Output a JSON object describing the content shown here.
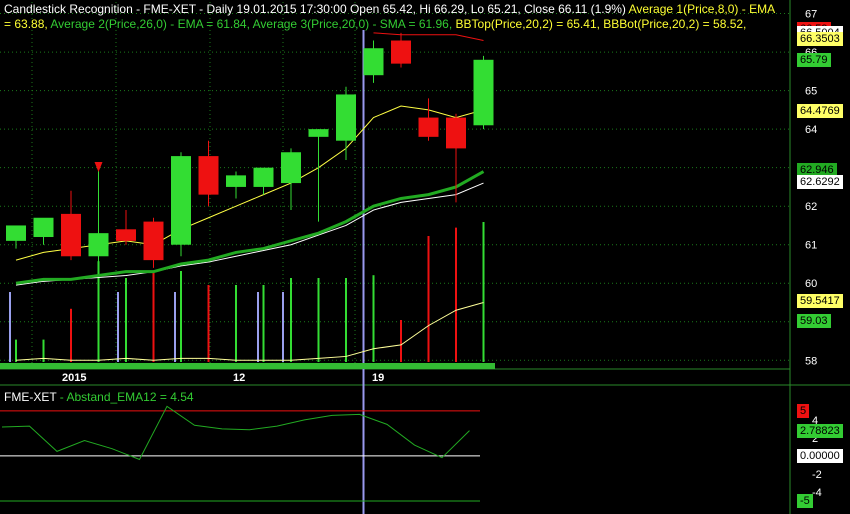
{
  "header": {
    "title": "Candlestick Recognition - FME-XET - Daily 19.01.2015 17:30:00 Open 65.42, Hi 66.29, Lo 65.21, Close 66.11 (1.9%)",
    "ma1_label": "Average 1(Price,8,0) - EMA",
    "ma1_value": "= 63.88,",
    "ma2_label": "Average 2(Price,26,0) - EMA = 61.84,",
    "ma3_label": "Average 3(Price,20,0) - SMA = 61.96,",
    "bbtop_label": "BBTop(Price,20,2) = 65.41,",
    "bbbot_label": "BBBot(Price,20,2) = 58.52,"
  },
  "subpanel": {
    "title": "FME-XET",
    "indicator": "- Abstand_EMA12 = 4.54"
  },
  "colors": {
    "bull": "#33dd33",
    "bear": "#ee1111",
    "ema8": "#ffff44",
    "ema26": "#22aa22",
    "sma20": "#66dd66",
    "bb": "#ffff99",
    "grid": "#1b7a1b",
    "cursor": "#9999ee"
  },
  "chart_data": [
    {
      "type": "candlestick",
      "x_ticks": [
        "2015",
        "12",
        "19"
      ],
      "y_ticks": [
        58,
        59,
        60,
        61,
        62,
        63,
        64,
        65,
        66,
        67
      ],
      "ylim": [
        57.8,
        67.3
      ],
      "candles": [
        {
          "open": 61.1,
          "high": 61.4,
          "low": 60.9,
          "close": 61.5
        },
        {
          "open": 61.2,
          "high": 61.6,
          "low": 61.0,
          "close": 61.7
        },
        {
          "open": 61.8,
          "high": 62.4,
          "low": 60.6,
          "close": 60.7
        },
        {
          "open": 60.7,
          "high": 63.1,
          "low": 60.3,
          "close": 61.3
        },
        {
          "open": 61.4,
          "high": 61.9,
          "low": 61.0,
          "close": 61.1
        },
        {
          "open": 61.6,
          "high": 61.7,
          "low": 60.4,
          "close": 60.6
        },
        {
          "open": 61.0,
          "high": 63.4,
          "low": 60.7,
          "close": 63.3
        },
        {
          "open": 63.3,
          "high": 63.7,
          "low": 62.0,
          "close": 62.3
        },
        {
          "open": 62.5,
          "high": 62.9,
          "low": 62.2,
          "close": 62.8
        },
        {
          "open": 62.5,
          "high": 62.9,
          "low": 62.3,
          "close": 63.0
        },
        {
          "open": 62.6,
          "high": 63.5,
          "low": 61.9,
          "close": 63.4
        },
        {
          "open": 63.8,
          "high": 64.0,
          "low": 61.6,
          "close": 64.0
        },
        {
          "open": 63.7,
          "high": 65.1,
          "low": 63.2,
          "close": 64.9
        },
        {
          "open": 65.4,
          "high": 66.3,
          "low": 65.2,
          "close": 66.1
        },
        {
          "open": 66.3,
          "high": 66.5,
          "low": 65.6,
          "close": 65.7
        },
        {
          "open": 64.3,
          "high": 64.8,
          "low": 63.7,
          "close": 63.8
        },
        {
          "open": 64.3,
          "high": 64.4,
          "low": 62.1,
          "close": 63.5
        },
        {
          "open": 64.1,
          "high": 65.9,
          "low": 64.0,
          "close": 65.8
        }
      ],
      "ema8": [
        60.6,
        60.8,
        60.9,
        61.0,
        61.1,
        61.0,
        61.4,
        61.7,
        62.0,
        62.3,
        62.6,
        63.0,
        63.5,
        64.3,
        64.6,
        64.5,
        64.3,
        64.5
      ],
      "ema26": [
        60.0,
        60.1,
        60.1,
        60.2,
        60.3,
        60.3,
        60.5,
        60.6,
        60.8,
        60.9,
        61.1,
        61.3,
        61.6,
        62.0,
        62.2,
        62.3,
        62.5,
        62.9
      ],
      "sma20": [
        59.95,
        60.05,
        60.1,
        60.15,
        60.2,
        60.3,
        60.45,
        60.55,
        60.7,
        60.85,
        61.0,
        61.25,
        61.5,
        61.9,
        62.1,
        62.2,
        62.3,
        62.6
      ],
      "bbtop": [
        null,
        null,
        null,
        null,
        null,
        null,
        null,
        null,
        null,
        null,
        null,
        null,
        null,
        66.5,
        66.45,
        66.45,
        66.45,
        66.3
      ],
      "bbbot": [
        58.0,
        58.05,
        58.0,
        58.0,
        58.05,
        58.0,
        58.05,
        58.05,
        58.0,
        58.0,
        58.0,
        58.05,
        58.1,
        58.3,
        58.4,
        58.9,
        59.3,
        59.5
      ],
      "volume_scale": [
        0,
        1
      ],
      "volume": [
        0.16,
        0.16,
        0.38,
        0.72,
        0.6,
        0.65,
        0.65,
        0.55,
        0.55,
        0.55,
        0.6,
        0.6,
        0.6,
        0.62,
        0.3,
        0.9,
        0.96,
        1.0
      ],
      "volume_dir": [
        "up",
        "up",
        "down",
        "up",
        "up",
        "down",
        "up",
        "down",
        "up",
        "up",
        "up",
        "up",
        "up",
        "up",
        "down",
        "down",
        "down",
        "up"
      ],
      "price_labels": [
        {
          "text": "66.59",
          "value": 66.59,
          "bg": "#ee1111",
          "fg": "#000000"
        },
        {
          "text": "66.5004",
          "value": 66.5,
          "bg": "#ffffff",
          "fg": "#000000"
        },
        {
          "text": "66.3503",
          "value": 66.35,
          "bg": "#ffff66",
          "fg": "#000000"
        },
        {
          "text": "65.79",
          "value": 65.79,
          "bg": "#33cc33",
          "fg": "#000000"
        },
        {
          "text": "64.4769",
          "value": 64.48,
          "bg": "#ffff66",
          "fg": "#000000"
        },
        {
          "text": "62.946",
          "value": 62.946,
          "bg": "#22aa22",
          "fg": "#000000"
        },
        {
          "text": "62.6292",
          "value": 62.63,
          "bg": "#ffffff",
          "fg": "#000000"
        },
        {
          "text": "59.5417",
          "value": 59.54,
          "bg": "#ffff66",
          "fg": "#000000"
        },
        {
          "text": "59.03",
          "value": 59.03,
          "bg": "#33cc33",
          "fg": "#000000"
        }
      ]
    },
    {
      "type": "line",
      "series": [
        {
          "values": [
            3.2,
            3.3,
            0.5,
            1.7,
            0.8,
            -0.4,
            5.5,
            3.4,
            3.0,
            2.9,
            3.3,
            4.0,
            4.5,
            4.6,
            3.5,
            1.2,
            -0.2,
            2.8
          ]
        }
      ],
      "y_ticks": [
        -4,
        -2,
        0,
        2,
        4
      ],
      "ylim": [
        -6,
        6.2
      ],
      "upper_level": 5,
      "lower_level": -5,
      "zero_level": 0,
      "value_labels": [
        {
          "text": "5",
          "value": 5,
          "bg": "#ee1111",
          "fg": "#000000"
        },
        {
          "text": "2.78823",
          "value": 2.78823,
          "bg": "#33cc33",
          "fg": "#000000"
        },
        {
          "text": "0.00000",
          "value": 0,
          "bg": "#ffffff",
          "fg": "#000000"
        },
        {
          "text": "-5",
          "value": -5,
          "bg": "#33cc33",
          "fg": "#000000"
        }
      ]
    }
  ]
}
